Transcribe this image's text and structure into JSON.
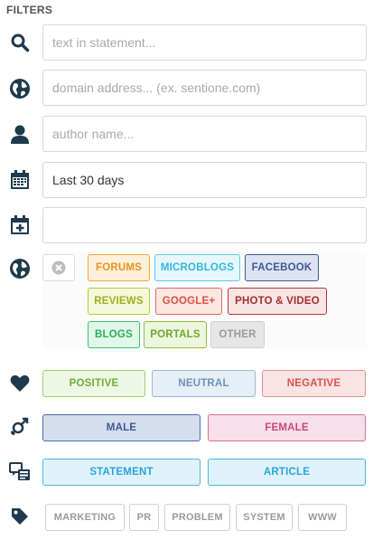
{
  "header": {
    "title": "FILTERS"
  },
  "inputs": {
    "statement": {
      "placeholder": "text in statement...",
      "value": ""
    },
    "domain": {
      "placeholder": "domain address... (ex. sentione.com)",
      "value": ""
    },
    "author": {
      "placeholder": "author name...",
      "value": ""
    },
    "date_range": {
      "placeholder": "",
      "value": "Last 30 days"
    },
    "custom_date": {
      "placeholder": "",
      "value": ""
    }
  },
  "sources": {
    "clear_icon": "close-circle-icon",
    "items": [
      "FORUMS",
      "MICROBLOGS",
      "FACEBOOK",
      "REVIEWS",
      "GOOGLE+",
      "PHOTO & VIDEO",
      "BLOGS",
      "PORTALS",
      "OTHER"
    ]
  },
  "sentiment": {
    "items": [
      "POSITIVE",
      "NEUTRAL",
      "NEGATIVE"
    ]
  },
  "gender": {
    "items": [
      "MALE",
      "FEMALE"
    ]
  },
  "content_type": {
    "items": [
      "STATEMENT",
      "ARTICLE"
    ]
  },
  "categories": {
    "items": [
      "MARKETING",
      "PR",
      "PROBLEM",
      "SYSTEM",
      "WWW"
    ]
  },
  "icons": {
    "statement": "search-icon",
    "domain": "globe-icon",
    "author": "person-icon",
    "date_range": "calendar-icon",
    "custom_date": "calendar-add-icon",
    "sources": "globe-icon",
    "sentiment": "heart-icon",
    "gender": "gender-icon",
    "content_type": "chat-screen-icon",
    "categories": "tag-icon"
  },
  "colors": {
    "icon": "#1f3a4d",
    "forums": "#e89521",
    "microblogs": "#35b6dd",
    "facebook": "#3b5998",
    "reviews": "#9caf1e",
    "google": "#d9533f",
    "photo_video": "#a2302c",
    "blogs": "#26b05a",
    "portals": "#6ea82a",
    "other": "#9a9a9a",
    "positive": "#6fae3a",
    "neutral": "#6a93ba",
    "negative": "#d9534f",
    "male": "#3d5a9a",
    "female": "#c94a7b",
    "statement": "#2aa3db",
    "article": "#2aa3db"
  }
}
